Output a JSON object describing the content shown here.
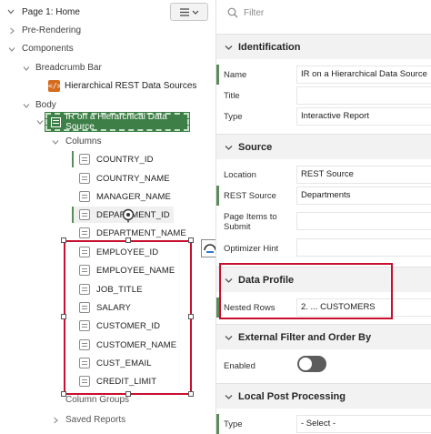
{
  "tree": {
    "page_title": "Page 1: Home",
    "nodes": {
      "pre_rendering": "Pre-Rendering",
      "components": "Components",
      "breadcrumb_bar": "Breadcrumb Bar",
      "breadcrumb_region": "Hierarchical REST Data Sources",
      "body": "Body",
      "ir_region": "IR on a Hierarchical Data Source",
      "columns": "Columns",
      "column_groups": "Column Groups",
      "saved_reports": "Saved Reports"
    },
    "columns": [
      "COUNTRY_ID",
      "COUNTRY_NAME",
      "MANAGER_NAME",
      "DEPARTMENT_ID",
      "DEPARTMENT_NAME",
      "EMPLOYEE_ID",
      "EMPLOYEE_NAME",
      "JOB_TITLE",
      "SALARY",
      "CUSTOMER_ID",
      "CUSTOMER_NAME",
      "CUST_EMAIL",
      "CREDIT_LIMIT"
    ]
  },
  "properties": {
    "filter_placeholder": "Filter",
    "sections": {
      "identification": "Identification",
      "source": "Source",
      "data_profile": "Data Profile",
      "external_filter": "External Filter and Order By",
      "local_post": "Local Post Processing"
    },
    "labels": {
      "name": "Name",
      "title": "Title",
      "type": "Type",
      "location": "Location",
      "rest_source": "REST Source",
      "page_items": "Page Items to Submit",
      "optimizer_hint": "Optimizer Hint",
      "nested_rows": "Nested Rows",
      "enabled": "Enabled",
      "lp_type": "Type"
    },
    "values": {
      "name": "IR on a Hierarchical Data Source",
      "title": "",
      "type": "Interactive Report",
      "location": "REST Source",
      "rest_source": "Departments",
      "page_items": "",
      "optimizer_hint": "",
      "nested_rows": "2. ... CUSTOMERS",
      "lp_type": "- Select -"
    },
    "enabled": false
  },
  "colors": {
    "selected_node": "#3d7f47",
    "highlight_border": "#c8102e",
    "breadcrumb_icon": "#d46b1d"
  }
}
